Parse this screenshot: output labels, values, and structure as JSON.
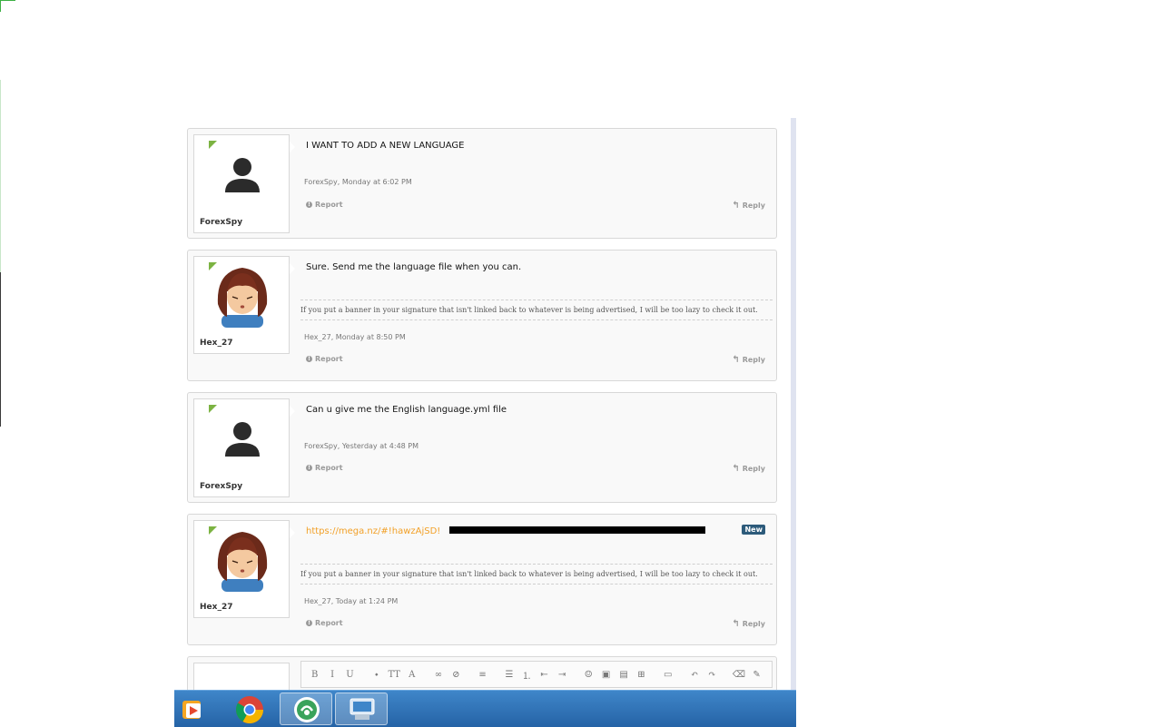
{
  "posts": [
    {
      "username": "ForexSpy",
      "avatar": "generic-user-icon",
      "message": "I WANT TO ADD A NEW LANGUAGE",
      "meta": "ForexSpy, Monday at 6:02 PM",
      "report_label": "Report",
      "reply_label": "Reply"
    },
    {
      "username": "Hex_27",
      "avatar": "anime-girl-avatar",
      "message": "Sure. Send me the language file when you can.",
      "signature": "If you put a banner in your signature that isn't linked back to whatever is being advertised, I will be too lazy to check it out.",
      "meta": "Hex_27, Monday at 8:50 PM",
      "report_label": "Report",
      "reply_label": "Reply"
    },
    {
      "username": "ForexSpy",
      "avatar": "generic-user-icon",
      "message": "Can u give me the English language.yml file",
      "meta": "ForexSpy, Yesterday at 4:48 PM",
      "report_label": "Report",
      "reply_label": "Reply"
    },
    {
      "username": "Hex_27",
      "avatar": "anime-girl-avatar",
      "message_link": "https://mega.nz/#!hawzAjSD!",
      "badge": "New",
      "signature": "If you put a banner in your signature that isn't linked back to whatever is being advertised, I will be too lazy to check it out.",
      "meta": "Hex_27, Today at 1:24 PM",
      "report_label": "Report",
      "reply_label": "Reply"
    }
  ],
  "editor": {
    "toolbar": [
      "bold-icon",
      "italic-icon",
      "underline-icon",
      "color-icon",
      "font-size-icon",
      "font-family-icon",
      "link-icon",
      "unlink-icon",
      "align-icon",
      "bullet-list-icon",
      "number-list-icon",
      "outdent-icon",
      "indent-icon",
      "smilie-icon",
      "image-icon",
      "media-icon",
      "insert-icon",
      "save-icon",
      "undo-icon",
      "redo-icon",
      "remove-format-icon",
      "wrench-icon"
    ],
    "toolbar_glyphs": [
      "B",
      "I",
      "U",
      "⬩",
      "TT",
      "A",
      "∞",
      "⊘",
      "≡",
      "☰",
      "⒈",
      "⇤",
      "⇥",
      "☺",
      "▣",
      "▤",
      "⊞",
      "▭",
      "↶",
      "↷",
      "⌫",
      "✎"
    ]
  },
  "taskbar": {
    "apps": [
      "media-player-icon",
      "chrome-icon",
      "cloud-app-icon",
      "remote-desktop-icon"
    ]
  },
  "colors": {
    "link": "#f2a027",
    "online": "#7cb342",
    "badge": "#2d5b7b",
    "taskbar": "#2f73b8"
  }
}
